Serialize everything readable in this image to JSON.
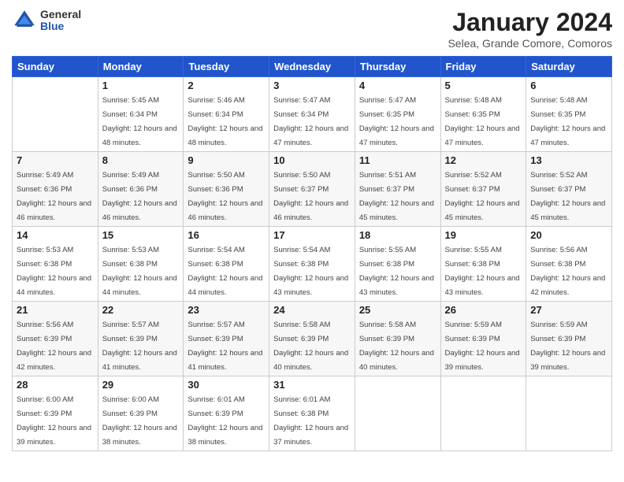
{
  "logo": {
    "general": "General",
    "blue": "Blue"
  },
  "title": "January 2024",
  "location": "Selea, Grande Comore, Comoros",
  "days_of_week": [
    "Sunday",
    "Monday",
    "Tuesday",
    "Wednesday",
    "Thursday",
    "Friday",
    "Saturday"
  ],
  "weeks": [
    [
      {
        "day": "",
        "sunrise": "",
        "sunset": "",
        "daylight": ""
      },
      {
        "day": "1",
        "sunrise": "Sunrise: 5:45 AM",
        "sunset": "Sunset: 6:34 PM",
        "daylight": "Daylight: 12 hours and 48 minutes."
      },
      {
        "day": "2",
        "sunrise": "Sunrise: 5:46 AM",
        "sunset": "Sunset: 6:34 PM",
        "daylight": "Daylight: 12 hours and 48 minutes."
      },
      {
        "day": "3",
        "sunrise": "Sunrise: 5:47 AM",
        "sunset": "Sunset: 6:34 PM",
        "daylight": "Daylight: 12 hours and 47 minutes."
      },
      {
        "day": "4",
        "sunrise": "Sunrise: 5:47 AM",
        "sunset": "Sunset: 6:35 PM",
        "daylight": "Daylight: 12 hours and 47 minutes."
      },
      {
        "day": "5",
        "sunrise": "Sunrise: 5:48 AM",
        "sunset": "Sunset: 6:35 PM",
        "daylight": "Daylight: 12 hours and 47 minutes."
      },
      {
        "day": "6",
        "sunrise": "Sunrise: 5:48 AM",
        "sunset": "Sunset: 6:35 PM",
        "daylight": "Daylight: 12 hours and 47 minutes."
      }
    ],
    [
      {
        "day": "7",
        "sunrise": "Sunrise: 5:49 AM",
        "sunset": "Sunset: 6:36 PM",
        "daylight": "Daylight: 12 hours and 46 minutes."
      },
      {
        "day": "8",
        "sunrise": "Sunrise: 5:49 AM",
        "sunset": "Sunset: 6:36 PM",
        "daylight": "Daylight: 12 hours and 46 minutes."
      },
      {
        "day": "9",
        "sunrise": "Sunrise: 5:50 AM",
        "sunset": "Sunset: 6:36 PM",
        "daylight": "Daylight: 12 hours and 46 minutes."
      },
      {
        "day": "10",
        "sunrise": "Sunrise: 5:50 AM",
        "sunset": "Sunset: 6:37 PM",
        "daylight": "Daylight: 12 hours and 46 minutes."
      },
      {
        "day": "11",
        "sunrise": "Sunrise: 5:51 AM",
        "sunset": "Sunset: 6:37 PM",
        "daylight": "Daylight: 12 hours and 45 minutes."
      },
      {
        "day": "12",
        "sunrise": "Sunrise: 5:52 AM",
        "sunset": "Sunset: 6:37 PM",
        "daylight": "Daylight: 12 hours and 45 minutes."
      },
      {
        "day": "13",
        "sunrise": "Sunrise: 5:52 AM",
        "sunset": "Sunset: 6:37 PM",
        "daylight": "Daylight: 12 hours and 45 minutes."
      }
    ],
    [
      {
        "day": "14",
        "sunrise": "Sunrise: 5:53 AM",
        "sunset": "Sunset: 6:38 PM",
        "daylight": "Daylight: 12 hours and 44 minutes."
      },
      {
        "day": "15",
        "sunrise": "Sunrise: 5:53 AM",
        "sunset": "Sunset: 6:38 PM",
        "daylight": "Daylight: 12 hours and 44 minutes."
      },
      {
        "day": "16",
        "sunrise": "Sunrise: 5:54 AM",
        "sunset": "Sunset: 6:38 PM",
        "daylight": "Daylight: 12 hours and 44 minutes."
      },
      {
        "day": "17",
        "sunrise": "Sunrise: 5:54 AM",
        "sunset": "Sunset: 6:38 PM",
        "daylight": "Daylight: 12 hours and 43 minutes."
      },
      {
        "day": "18",
        "sunrise": "Sunrise: 5:55 AM",
        "sunset": "Sunset: 6:38 PM",
        "daylight": "Daylight: 12 hours and 43 minutes."
      },
      {
        "day": "19",
        "sunrise": "Sunrise: 5:55 AM",
        "sunset": "Sunset: 6:38 PM",
        "daylight": "Daylight: 12 hours and 43 minutes."
      },
      {
        "day": "20",
        "sunrise": "Sunrise: 5:56 AM",
        "sunset": "Sunset: 6:38 PM",
        "daylight": "Daylight: 12 hours and 42 minutes."
      }
    ],
    [
      {
        "day": "21",
        "sunrise": "Sunrise: 5:56 AM",
        "sunset": "Sunset: 6:39 PM",
        "daylight": "Daylight: 12 hours and 42 minutes."
      },
      {
        "day": "22",
        "sunrise": "Sunrise: 5:57 AM",
        "sunset": "Sunset: 6:39 PM",
        "daylight": "Daylight: 12 hours and 41 minutes."
      },
      {
        "day": "23",
        "sunrise": "Sunrise: 5:57 AM",
        "sunset": "Sunset: 6:39 PM",
        "daylight": "Daylight: 12 hours and 41 minutes."
      },
      {
        "day": "24",
        "sunrise": "Sunrise: 5:58 AM",
        "sunset": "Sunset: 6:39 PM",
        "daylight": "Daylight: 12 hours and 40 minutes."
      },
      {
        "day": "25",
        "sunrise": "Sunrise: 5:58 AM",
        "sunset": "Sunset: 6:39 PM",
        "daylight": "Daylight: 12 hours and 40 minutes."
      },
      {
        "day": "26",
        "sunrise": "Sunrise: 5:59 AM",
        "sunset": "Sunset: 6:39 PM",
        "daylight": "Daylight: 12 hours and 39 minutes."
      },
      {
        "day": "27",
        "sunrise": "Sunrise: 5:59 AM",
        "sunset": "Sunset: 6:39 PM",
        "daylight": "Daylight: 12 hours and 39 minutes."
      }
    ],
    [
      {
        "day": "28",
        "sunrise": "Sunrise: 6:00 AM",
        "sunset": "Sunset: 6:39 PM",
        "daylight": "Daylight: 12 hours and 39 minutes."
      },
      {
        "day": "29",
        "sunrise": "Sunrise: 6:00 AM",
        "sunset": "Sunset: 6:39 PM",
        "daylight": "Daylight: 12 hours and 38 minutes."
      },
      {
        "day": "30",
        "sunrise": "Sunrise: 6:01 AM",
        "sunset": "Sunset: 6:39 PM",
        "daylight": "Daylight: 12 hours and 38 minutes."
      },
      {
        "day": "31",
        "sunrise": "Sunrise: 6:01 AM",
        "sunset": "Sunset: 6:38 PM",
        "daylight": "Daylight: 12 hours and 37 minutes."
      },
      {
        "day": "",
        "sunrise": "",
        "sunset": "",
        "daylight": ""
      },
      {
        "day": "",
        "sunrise": "",
        "sunset": "",
        "daylight": ""
      },
      {
        "day": "",
        "sunrise": "",
        "sunset": "",
        "daylight": ""
      }
    ]
  ]
}
